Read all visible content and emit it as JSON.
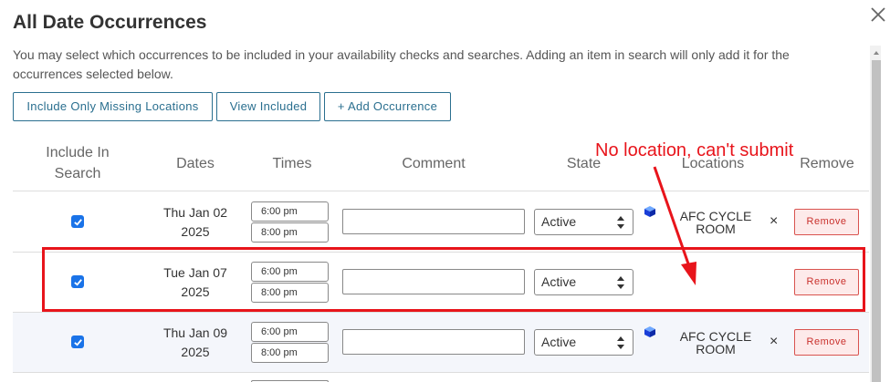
{
  "dialog": {
    "title": "All Date Occurrences",
    "description": "You may select which occurrences to be included in your availability checks and searches. Adding an item in search will only add it for the occurrences selected below."
  },
  "actions": {
    "include_missing": "Include Only Missing Locations",
    "view_included": "View Included",
    "add_occurrence": "+ Add Occurrence"
  },
  "table": {
    "headers": {
      "include": "Include In Search",
      "dates": "Dates",
      "times": "Times",
      "comment": "Comment",
      "state": "State",
      "locations": "Locations",
      "remove": "Remove"
    },
    "rows": [
      {
        "included": true,
        "day": "Thu Jan 02",
        "year": "2025",
        "start": "6:00 pm",
        "end": "8:00 pm",
        "comment": "",
        "state": "Active",
        "location": "AFC CYCLE ROOM",
        "remove_label": "Remove"
      },
      {
        "included": true,
        "day": "Tue Jan 07",
        "year": "2025",
        "start": "6:00 pm",
        "end": "8:00 pm",
        "comment": "",
        "state": "Active",
        "location": "",
        "remove_label": "Remove"
      },
      {
        "included": true,
        "day": "Thu Jan 09",
        "year": "2025",
        "start": "6:00 pm",
        "end": "8:00 pm",
        "comment": "",
        "state": "Active",
        "location": "AFC CYCLE ROOM",
        "remove_label": "Remove"
      }
    ]
  },
  "annotation": {
    "text": "No location, can't submit",
    "color": "#e8141b"
  },
  "icons": {
    "close": "close-icon",
    "location": "cube-icon",
    "checkbox": "checkmark-icon"
  },
  "colors": {
    "accent": "#2a6f8f",
    "checkbox": "#1a73e8",
    "remove_border": "#d9534f",
    "remove_bg": "#fdeaea",
    "alt_row": "#f4f6fb"
  }
}
